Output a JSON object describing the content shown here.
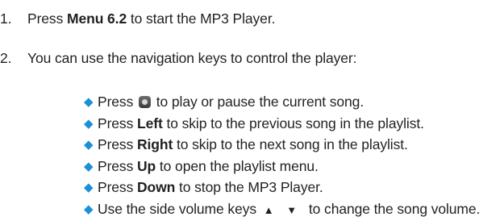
{
  "steps": [
    {
      "number": "1.",
      "pre": "Press ",
      "bold": "Menu 6.2",
      "post": " to start the MP3 Player."
    },
    {
      "number": "2.",
      "text": "You can use the navigation keys to control the player:"
    }
  ],
  "bullets": [
    {
      "pre": "Press ",
      "icon": "center-key-icon",
      "post": " to play or pause the current song."
    },
    {
      "pre": "Press ",
      "bold": "Left",
      "post": " to skip to the previous song in the playlist."
    },
    {
      "pre": "Press ",
      "bold": "Right",
      "post": " to skip to the next song in the playlist."
    },
    {
      "pre": "Press ",
      "bold": "Up",
      "post": " to open the playlist menu."
    },
    {
      "pre": "Press ",
      "bold": "Down",
      "post": " to stop the MP3 Player."
    },
    {
      "pre": "Use the side volume keys ",
      "symbols": "▲ ▼",
      "post": " to change the song volume."
    }
  ],
  "bullet_glyph": "◆",
  "colors": {
    "text": "#231f20",
    "bullet": "#1b8fd8"
  }
}
